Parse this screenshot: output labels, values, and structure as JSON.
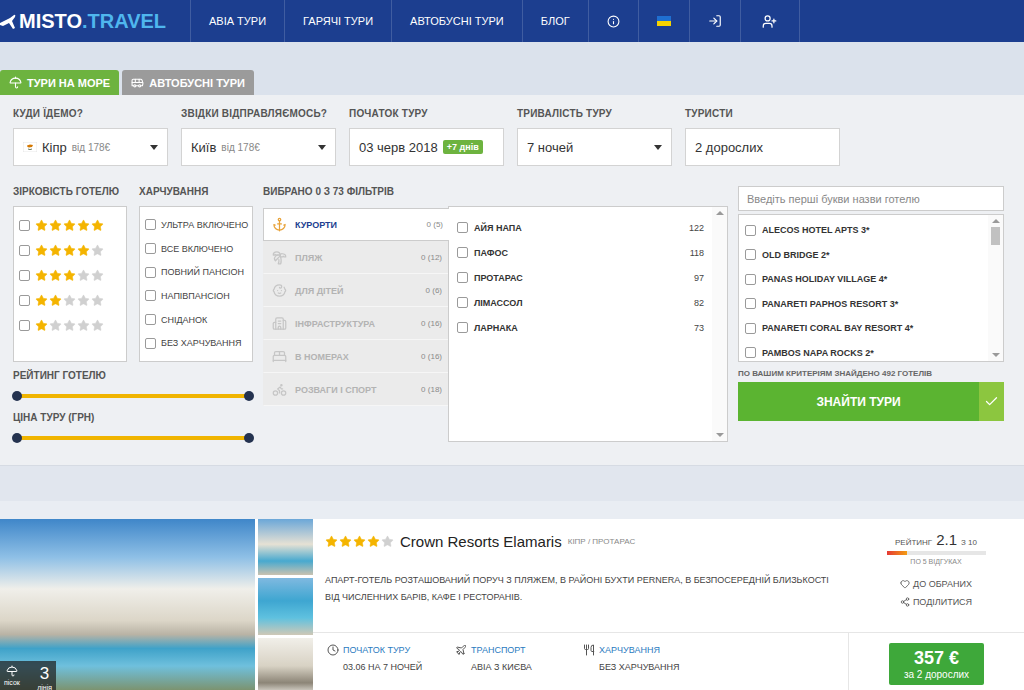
{
  "header": {
    "logo": {
      "brand": "MISTO",
      "domain": ".TRAVEL"
    },
    "nav": [
      "АВІА ТУРИ",
      "ГАРЯЧІ ТУРИ",
      "АВТОБУСНІ ТУРИ",
      "БЛОГ"
    ]
  },
  "tabs": [
    {
      "label": "ТУРИ НА МОРЕ",
      "kind": "sea",
      "selected": true
    },
    {
      "label": "АВТОБУСНІ ТУРИ",
      "kind": "bus",
      "selected": false
    }
  ],
  "search_fields": [
    {
      "label": "КУДИ ЇДЕМО?",
      "kind": "country",
      "value": "Кіпр",
      "note": "від 178€"
    },
    {
      "label": "ЗВІДКИ ВІДПРАВЛЯЄМОСЬ?",
      "kind": "select",
      "value": "Київ",
      "note": "від 178€"
    },
    {
      "label": "ПОЧАТОК ТУРУ",
      "kind": "date",
      "value": "03 черв 2018",
      "badge": "+7 днів"
    },
    {
      "label": "ТРИВАЛІСТЬ ТУРУ",
      "kind": "select",
      "value": "7 ночей"
    },
    {
      "label": "ТУРИСТИ",
      "kind": "text",
      "value": "2 дорослих"
    }
  ],
  "hotel_stars": {
    "title": "ЗІРКОВІСТЬ ГОТЕЛЮ",
    "options": [
      {
        "stars": 5,
        "checked": false
      },
      {
        "stars": 4,
        "checked": false
      },
      {
        "stars": 3,
        "checked": false
      },
      {
        "stars": 2,
        "checked": false
      },
      {
        "stars": 1,
        "checked": false
      }
    ]
  },
  "meals": {
    "title": "ХАРЧУВАННЯ",
    "options": [
      {
        "label": "УЛЬТРА ВКЛЮЧЕНО",
        "checked": false
      },
      {
        "label": "ВСЕ ВКЛЮЧЕНО",
        "checked": false
      },
      {
        "label": "ПОВНИЙ ПАНСІОН",
        "checked": false
      },
      {
        "label": "НАПІВПАНСІОН",
        "checked": false
      },
      {
        "label": "СНІДАНОК",
        "checked": false
      },
      {
        "label": "БЕЗ ХАРЧУВАННЯ",
        "checked": false
      }
    ]
  },
  "sliders": [
    {
      "label": "РЕЙТИНГ ГОТЕЛЮ",
      "low": 0,
      "high": 1
    },
    {
      "label": "ЦІНА ТУРУ (ГРН)",
      "low": 0,
      "high": 1
    }
  ],
  "filters": {
    "title": "ВИБРАНО 0 З 73 ФІЛЬТРІВ",
    "categories": [
      {
        "label": "КУРОРТИ",
        "count": "0 (5)",
        "kind": "resorts",
        "selected": true
      },
      {
        "label": "ПЛЯЖ",
        "count": "0 (12)",
        "kind": "beach",
        "selected": false
      },
      {
        "label": "ДЛЯ ДІТЕЙ",
        "count": "0 (6)",
        "kind": "kids",
        "selected": false
      },
      {
        "label": "ІНФРАСТРУКТУРА",
        "count": "0 (16)",
        "kind": "infrastructure",
        "selected": false
      },
      {
        "label": "В НОМЕРАХ",
        "count": "0 (16)",
        "kind": "rooms",
        "selected": false
      },
      {
        "label": "РОЗВАГИ І СПОРТ",
        "count": "0 (18)",
        "kind": "sport",
        "selected": false
      }
    ],
    "options": [
      {
        "label": "АЙЯ НАПА",
        "count": "122",
        "checked": false
      },
      {
        "label": "ПАФОС",
        "count": "118",
        "checked": false
      },
      {
        "label": "ПРОТАРАС",
        "count": "97",
        "checked": false
      },
      {
        "label": "ЛІМАССОЛ",
        "count": "82",
        "checked": false
      },
      {
        "label": "ЛАРНАКА",
        "count": "73",
        "checked": false
      }
    ]
  },
  "hotels": {
    "placeholder": "Введіть перші букви назви готелю",
    "items": [
      {
        "name": "ALECOS HOTEL APTS 3*",
        "checked": false
      },
      {
        "name": "OLD BRIDGE 2*",
        "checked": false
      },
      {
        "name": "PANAS HOLIDAY VILLAGE 4*",
        "checked": false
      },
      {
        "name": "PANARETI PAPHOS RESORT 3*",
        "checked": false
      },
      {
        "name": "PANARETI CORAL BAY RESORT 4*",
        "checked": false
      },
      {
        "name": "PAMBOS NAPA ROCKS 2*",
        "checked": false
      }
    ],
    "found": "ПО ВАШИМ КРИТЕРІЯМ ЗНАЙДЕНО 492 ГОТЕЛІВ",
    "button": "ЗНАЙТИ ТУРИ"
  },
  "result": {
    "stars": 4,
    "name": "Crown Resorts Elamaris",
    "location": "КІПР / ПРОТАРАС",
    "description": "АПАРТ-ГОТЕЛЬ РОЗТАШОВАНИЙ ПОРУЧ З ПЛЯЖЕМ, В РАЙОНІ БУХТИ PERNERA, В БЕЗПОСЕРЕДНІЙ БЛИЗЬКОСТІ ВІД ЧИСЛЕННИХ БАРІВ, КАФЕ І РЕСТОРАНІВ.",
    "photo_badge": {
      "beach": "пісок",
      "line": "3",
      "line_label": "лінія"
    },
    "rating": {
      "label": "РЕЙТИНГ",
      "value": "2.1",
      "scale": "З 10",
      "level": 0.21,
      "reviews": "ПО 5 ВІДГУКАХ"
    },
    "favorite": "ДО ОБРАНИХ",
    "share": "ПОДІЛИТИСЯ",
    "details": [
      {
        "kind": "start",
        "label": "ПОЧАТОК ТУРУ",
        "value": "03.06 НА 7 НОЧЕЙ"
      },
      {
        "kind": "transport",
        "label": "ТРАНСПОРТ",
        "value": "АВІА З КИЄВА"
      },
      {
        "kind": "meals",
        "label": "ХАРЧУВАННЯ",
        "value": "БЕЗ ХАРЧУВАННЯ"
      }
    ],
    "price": "357 €",
    "price_note": "за 2 дорослих"
  }
}
